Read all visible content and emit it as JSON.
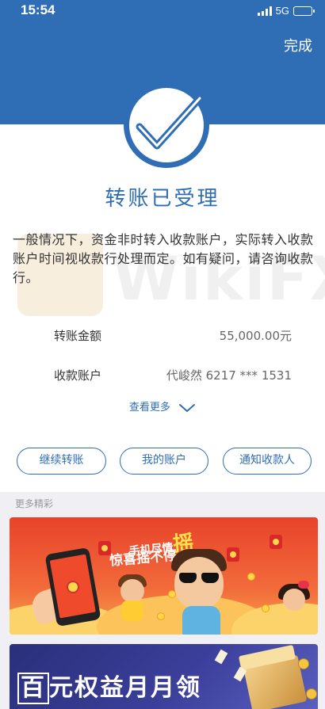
{
  "status_bar": {
    "time": "15:54",
    "network": "5G"
  },
  "header": {
    "done_label": "完成"
  },
  "result": {
    "title": "转账已受理",
    "description": "一般情况下，资金非时转入收款账户，实际转入收款账户时间视收款行处理而定。如有疑问，请咨询收款行。"
  },
  "details": {
    "amount_label": "转账金额",
    "amount_value": "55,000.00元",
    "account_label": "收款账户",
    "account_value": "代峻然 6217 *** 1531"
  },
  "more_toggle_label": "查看更多",
  "actions": {
    "continue_label": "继续转账",
    "my_account_label": "我的账户",
    "notify_label": "通知收款人"
  },
  "more_section": {
    "label": "更多精彩",
    "banner1": {
      "line1": "手机尽情",
      "line1_big": "摇",
      "line2": "惊喜摇不停"
    },
    "banner2": {
      "first_char": "百",
      "rest": "元权益月月领"
    }
  },
  "watermark_text": "WikiFX",
  "colors": {
    "primary": "#2f6db5",
    "background_gray": "#efeff4"
  },
  "icons": [
    "signal-icon",
    "battery-icon",
    "check-mark-icon",
    "chevron-down-icon"
  ]
}
